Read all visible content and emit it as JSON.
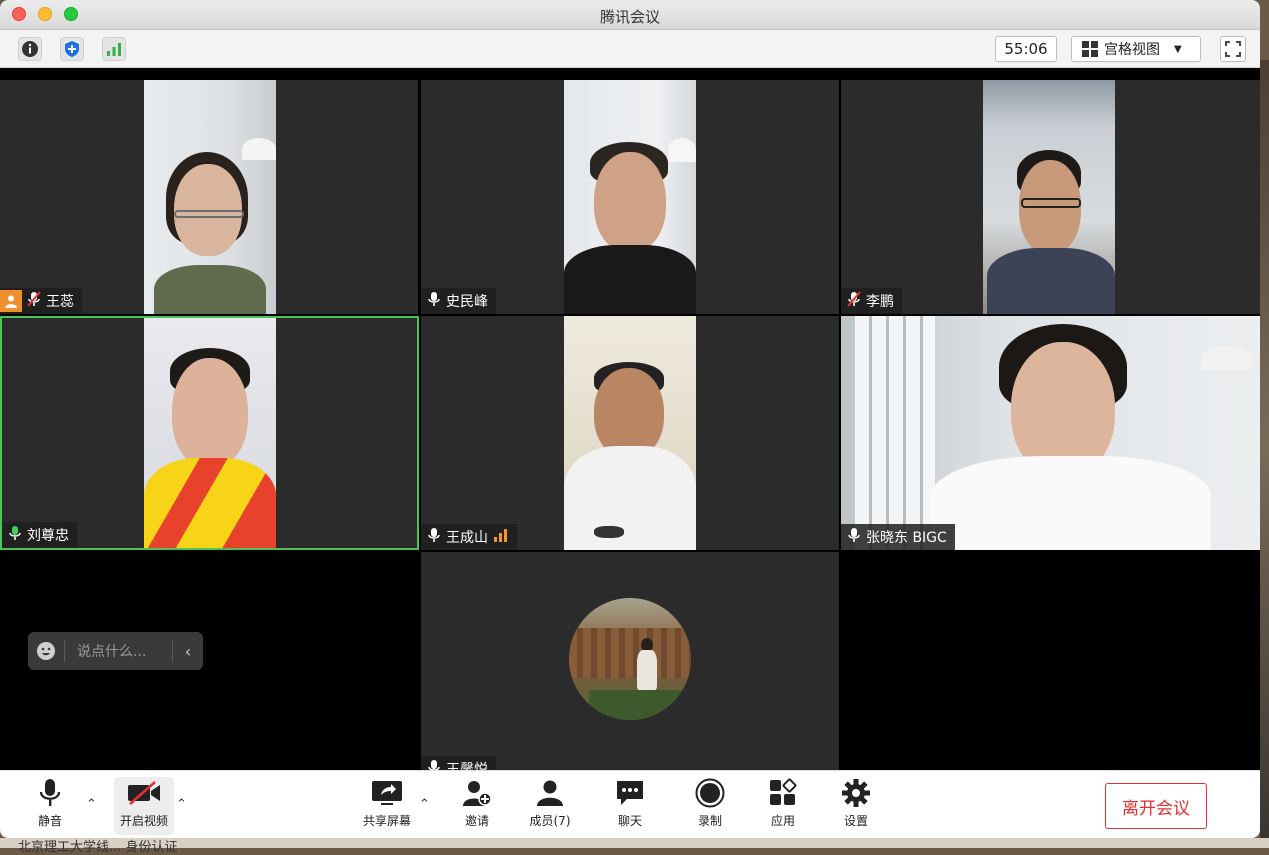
{
  "window": {
    "title": "腾讯会议"
  },
  "toolbar": {
    "info_icon": "info-icon",
    "security_icon": "shield-plus-icon",
    "signal_icon": "signal-bars-icon",
    "timer": "55:06",
    "view_label": "宫格视图",
    "fullscreen_icon": "fullscreen-icon"
  },
  "participants": [
    {
      "name": "王蕊",
      "mic": "muted",
      "host_badge": true
    },
    {
      "name": "史民峰",
      "mic": "on"
    },
    {
      "name": "李鹏",
      "mic": "muted"
    },
    {
      "name": "刘尊忠",
      "mic": "speaking",
      "active": true
    },
    {
      "name": "王成山",
      "mic": "on",
      "signal": "weak"
    },
    {
      "name": "张晓东 BIGC",
      "mic": "on"
    },
    {
      "name": "王馨悦",
      "mic": "on",
      "avatar_only": true
    }
  ],
  "chat": {
    "placeholder": "说点什么..."
  },
  "bottombar": {
    "mute": "静音",
    "video": "开启视频",
    "share": "共享屏幕",
    "invite": "邀请",
    "members": "成员(7)",
    "chat": "聊天",
    "record": "录制",
    "apps": "应用",
    "settings": "设置",
    "leave": "离开会议"
  },
  "colors": {
    "active_border": "#4cc25a",
    "leave": "#e03131",
    "mic_green": "#3fcf5a",
    "signal_orange": "#f39a1e",
    "host_orange": "#f0902c"
  },
  "desktop": {
    "bottom_text": "北京理工大学线... 身份认证"
  }
}
